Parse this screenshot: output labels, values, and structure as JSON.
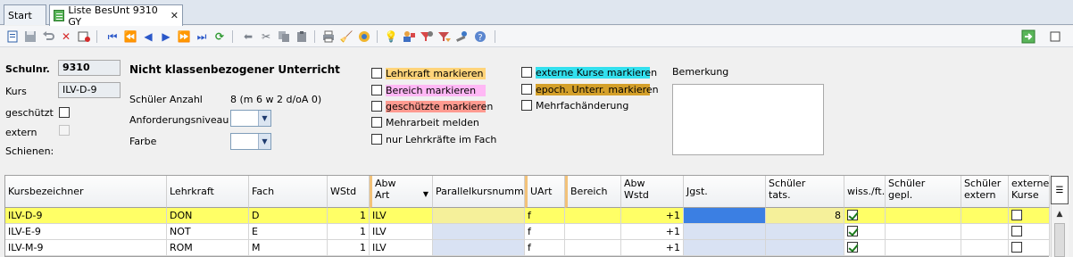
{
  "tabs": [
    {
      "label": "Start"
    },
    {
      "label": "Liste BesUnt 9310 GY",
      "close": "✕"
    }
  ],
  "toolbar": {
    "icons": [
      "new-record-icon",
      "save-icon",
      "undo-icon",
      "delete-icon",
      "delete-all-icon",
      "first-record-icon",
      "previous-page-icon",
      "previous-record-icon",
      "next-record-icon",
      "next-page-icon",
      "last-record-icon",
      "refresh-icon",
      "back-arrow-icon",
      "cut-icon",
      "copy-icon",
      "paste-icon",
      "print-icon",
      "clean-icon",
      "settings-icon",
      "hint-icon",
      "teacher-assign-icon",
      "filter-red-icon",
      "filter-icon",
      "wizard-icon",
      "help-icon",
      "export-icon"
    ]
  },
  "form": {
    "schulnr": {
      "label": "Schulnr.",
      "value": "9310"
    },
    "kurs": {
      "label": "Kurs",
      "value": "ILV-D-9"
    },
    "geschuetzt": {
      "label": "geschützt"
    },
    "extern": {
      "label": "extern"
    },
    "schienen": {
      "label": "Schienen:"
    },
    "heading": "Nicht klassenbezogener Unterricht",
    "schueler_anzahl": {
      "label": "Schüler Anzahl",
      "value": "8 (m 6 w 2 d/oA 0)"
    },
    "anforderungsniveau": {
      "label": "Anforderungsniveau",
      "value": ""
    },
    "farbe": {
      "label": "Farbe",
      "value": ""
    },
    "bemerkung": {
      "label": "Bemerkung"
    }
  },
  "legend": {
    "left": [
      {
        "label": "Lehrkraft markieren",
        "color": "#ffd47a"
      },
      {
        "label": "Bereich markieren",
        "color": "#ffb8f5"
      },
      {
        "label": "geschützte markieren",
        "color": "#ff9a90"
      },
      {
        "label": "Mehrarbeit melden",
        "color": ""
      },
      {
        "label": "nur Lehrkräfte im Fach",
        "color": ""
      }
    ],
    "right": [
      {
        "label": "externe Kurse markieren",
        "color": "#33e0ee"
      },
      {
        "label": "epoch. Unterr. markieren",
        "color": "#d4a02a"
      },
      {
        "label": "Mehrfachänderung",
        "color": ""
      }
    ]
  },
  "grid": {
    "columns": [
      {
        "label": "Kursbezeichner"
      },
      {
        "label": "Lehrkraft"
      },
      {
        "label": "Fach"
      },
      {
        "label": "WStd"
      },
      {
        "label": "Abw Art"
      },
      {
        "label": "Parallelkursnummer"
      },
      {
        "label": "UArt"
      },
      {
        "label": "Bereich"
      },
      {
        "label": "Abw Wstd"
      },
      {
        "label": "Jgst."
      },
      {
        "label": "Schüler tats."
      },
      {
        "label": "wiss./ft."
      },
      {
        "label": "Schüler gepl."
      },
      {
        "label": "Schüler extern"
      },
      {
        "label": "externe Kurse"
      }
    ],
    "rows": [
      {
        "kurs": "ILV-D-9",
        "lehrkraft": "DON",
        "fach": "D",
        "wstd": "1",
        "abwart": "ILV",
        "parallel": "",
        "uart": "f",
        "bereich": "",
        "abwwstd": "+1",
        "jgst": "",
        "schueler_tats": "8",
        "wiss": true,
        "gepl": "",
        "extern_sch": "",
        "externe_kurse": false
      },
      {
        "kurs": "ILV-E-9",
        "lehrkraft": "NOT",
        "fach": "E",
        "wstd": "1",
        "abwart": "ILV",
        "parallel": "",
        "uart": "f",
        "bereich": "",
        "abwwstd": "+1",
        "jgst": "",
        "schueler_tats": "",
        "wiss": true,
        "gepl": "",
        "extern_sch": "",
        "externe_kurse": false
      },
      {
        "kurs": "ILV-M-9",
        "lehrkraft": "ROM",
        "fach": "M",
        "wstd": "1",
        "abwart": "ILV",
        "parallel": "",
        "uart": "f",
        "bereich": "",
        "abwwstd": "+1",
        "jgst": "",
        "schueler_tats": "",
        "wiss": true,
        "gepl": "",
        "extern_sch": "",
        "externe_kurse": false
      }
    ],
    "selected_row_color": "#ffff66",
    "jgst_selected_color": "#3b7fe3"
  }
}
